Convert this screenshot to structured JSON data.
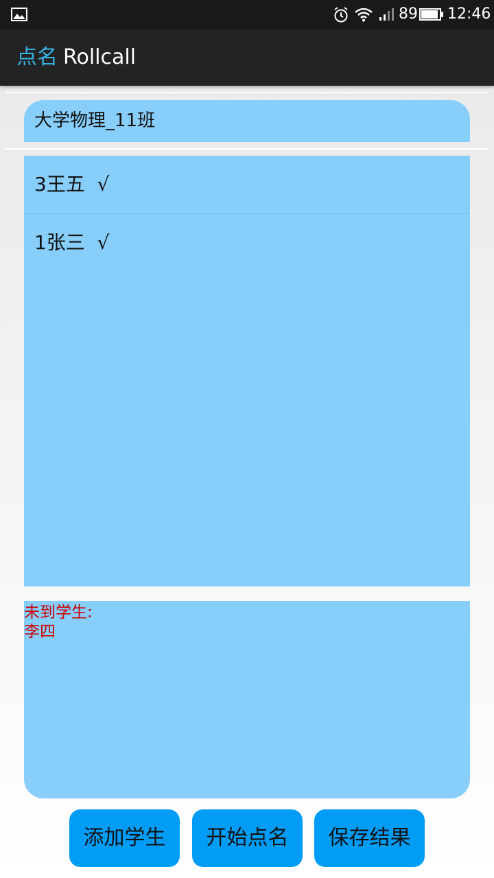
{
  "status_bar": {
    "battery_level": "89",
    "time": "12:46",
    "icons": [
      "gallery-icon",
      "alarm-icon",
      "wifi-icon",
      "signal-icon",
      "battery-icon"
    ]
  },
  "app_bar": {
    "title_zh": "点名",
    "title_en": "Rollcall"
  },
  "class_select": {
    "value": "大学物理_11班"
  },
  "students": [
    {
      "text": "3王五  √"
    },
    {
      "text": "1张三  √"
    }
  ],
  "absent": {
    "heading": "未到学生:",
    "names": [
      "李四"
    ]
  },
  "buttons": {
    "add_student": "添加学生",
    "start_rollcall": "开始点名",
    "save_results": "保存结果"
  },
  "colors": {
    "panel_bg": "#87cefa",
    "button_bg": "#009cf5",
    "accent": "#34b3e4",
    "absent_text": "#cc0000"
  }
}
